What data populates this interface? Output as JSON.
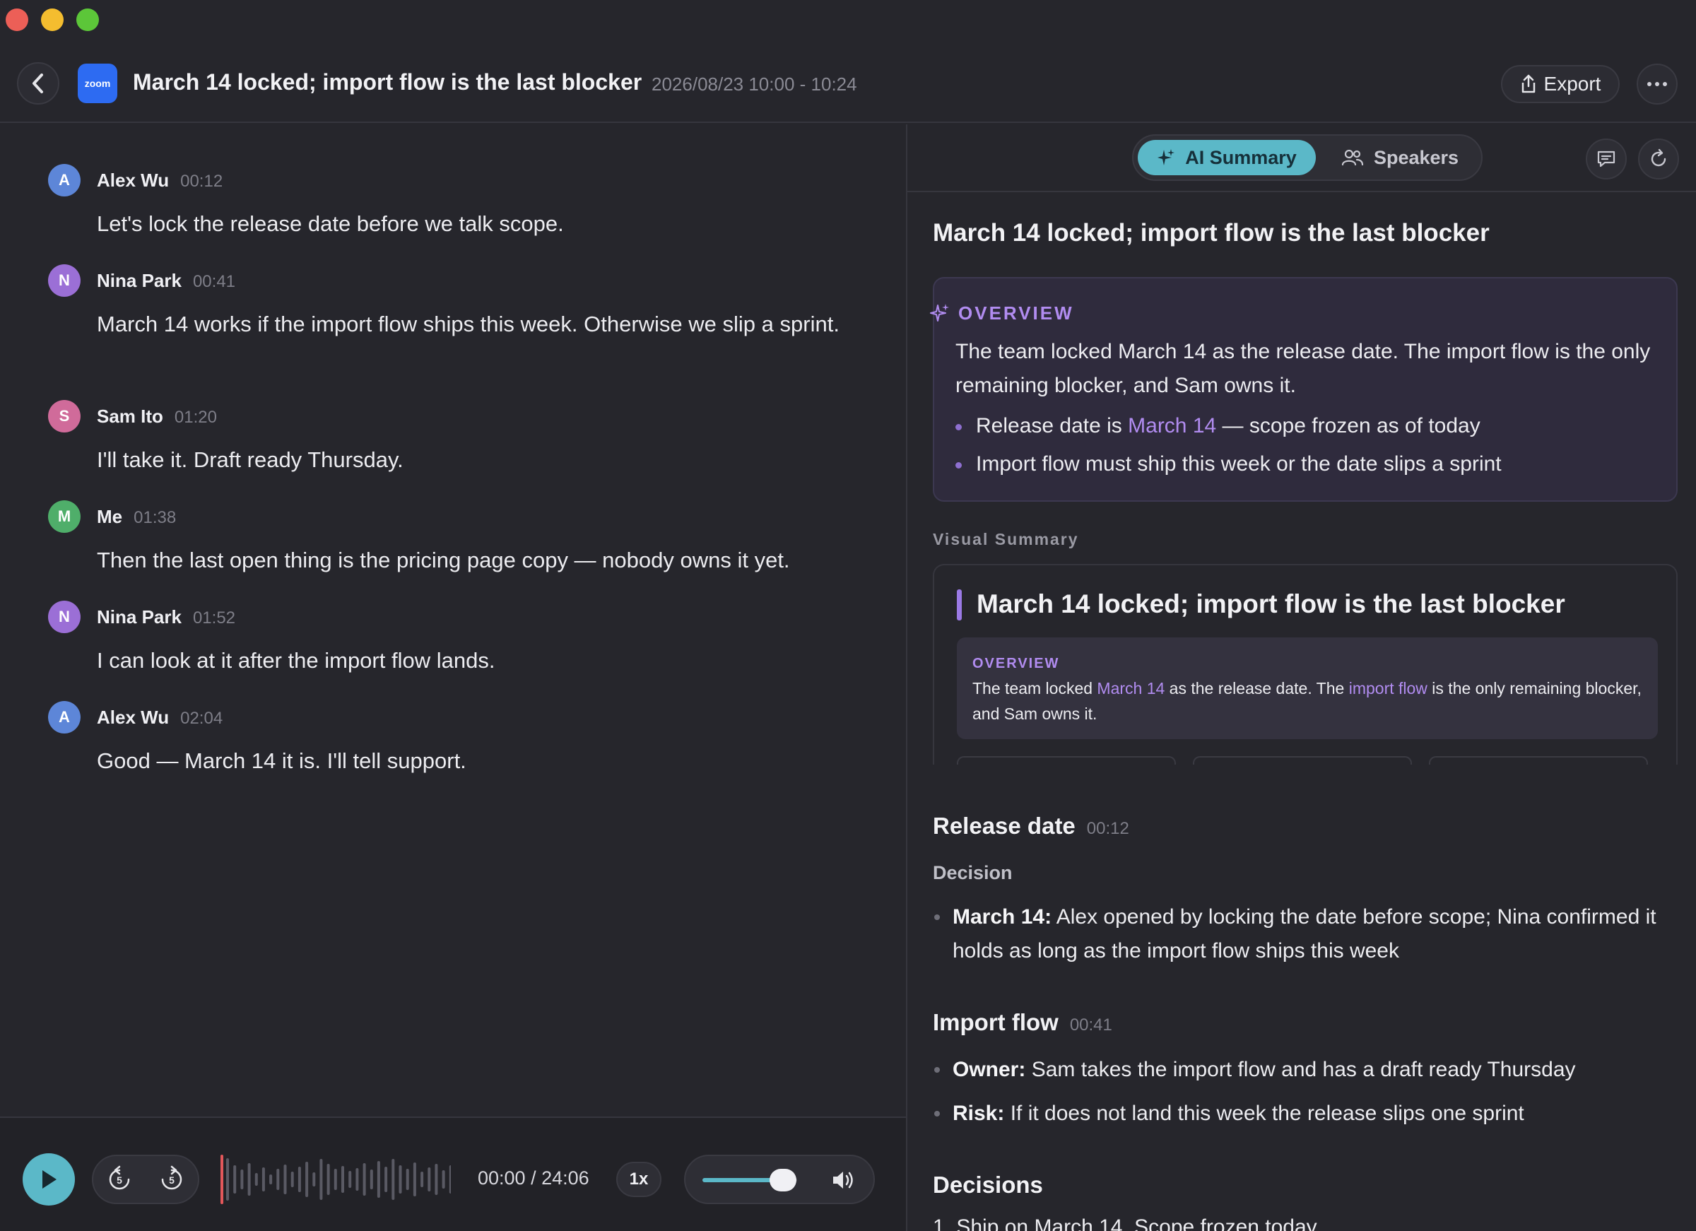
{
  "header": {
    "app_logo": "zoom",
    "title": "March 14 locked; import flow is the last blocker",
    "time": "2026/08/23 10:00 - 10:24",
    "export_label": "Export",
    "more_icon": "ellipsis-icon"
  },
  "transcript": [
    {
      "initial": "A",
      "name": "Alex Wu",
      "time": "00:12",
      "text": "Let's lock the release date before we talk scope.",
      "color": "#5d86d8"
    },
    {
      "initial": "N",
      "name": "Nina Park",
      "time": "00:41",
      "text": "March 14 works if the import flow ships this week. Otherwise we slip a sprint.",
      "color": "#9b6fd6"
    },
    {
      "initial": "S",
      "name": "Sam Ito",
      "time": "01:20",
      "text": "I'll take it. Draft ready Thursday.",
      "color": "#d06b9a"
    },
    {
      "initial": "M",
      "name": "Me",
      "time": "01:38",
      "text": "Then the last open thing is the pricing page copy — nobody owns it yet.",
      "color": "#4fae6a"
    },
    {
      "initial": "N",
      "name": "Nina Park",
      "time": "01:52",
      "text": "I can look at it after the import flow lands.",
      "color": "#9b6fd6"
    },
    {
      "initial": "A",
      "name": "Alex Wu",
      "time": "02:04",
      "text": "Good — March 14 it is. I'll tell support.",
      "color": "#5d86d8"
    }
  ],
  "player": {
    "time": "00:00 / 24:06",
    "speed": "1x",
    "volume": 0.85,
    "progress": 0,
    "skip_back": "5",
    "skip_forward": "5"
  },
  "tabs": {
    "ai_summary": "AI Summary",
    "speakers": "Speakers"
  },
  "summary": {
    "title": "March 14 locked; import flow is the last blocker",
    "overview_label": "OVERVIEW",
    "overview_text": "The team locked March 14 as the release date. The import flow is the only remaining blocker, and Sam owns it.",
    "bullet1_a": "Release date is ",
    "bullet1_accent": "March 14",
    "bullet1_b": " — scope frozen as of today",
    "bullet2": "Import flow must ship this week or the date slips a sprint",
    "visual_label": "Visual Summary",
    "visual_title": "March 14 locked; import flow is the last blocker",
    "visual_overview_label": "OVERVIEW",
    "visual_text_a": "The team locked ",
    "visual_text_accent1": "March 14",
    "visual_text_b": " as the release date. The ",
    "visual_text_accent2": "import flow",
    "visual_text_c": " is the only remaining blocker, and Sam owns it.",
    "sections": {
      "release": {
        "title": "Release date",
        "time": "00:12",
        "sub": "Decision",
        "b1_label": "March 14:",
        "b1_text": " Alex opened by locking the date before scope; Nina confirmed it holds as long as the import flow ships this week"
      },
      "import": {
        "title": "Import flow",
        "time": "00:41",
        "b1_label": "Owner:",
        "b1_text": " Sam takes the import flow and has a draft ready Thursday",
        "b2_label": "Risk:",
        "b2_text": " If it does not land this week the release slips one sprint"
      },
      "decisions": {
        "title": "Decisions",
        "item1": "1.   Ship on March 14. Scope frozen today"
      }
    }
  },
  "colors": {
    "accent": "#5bb8c8",
    "purple": "#b18cf0",
    "background": "#26262c"
  }
}
